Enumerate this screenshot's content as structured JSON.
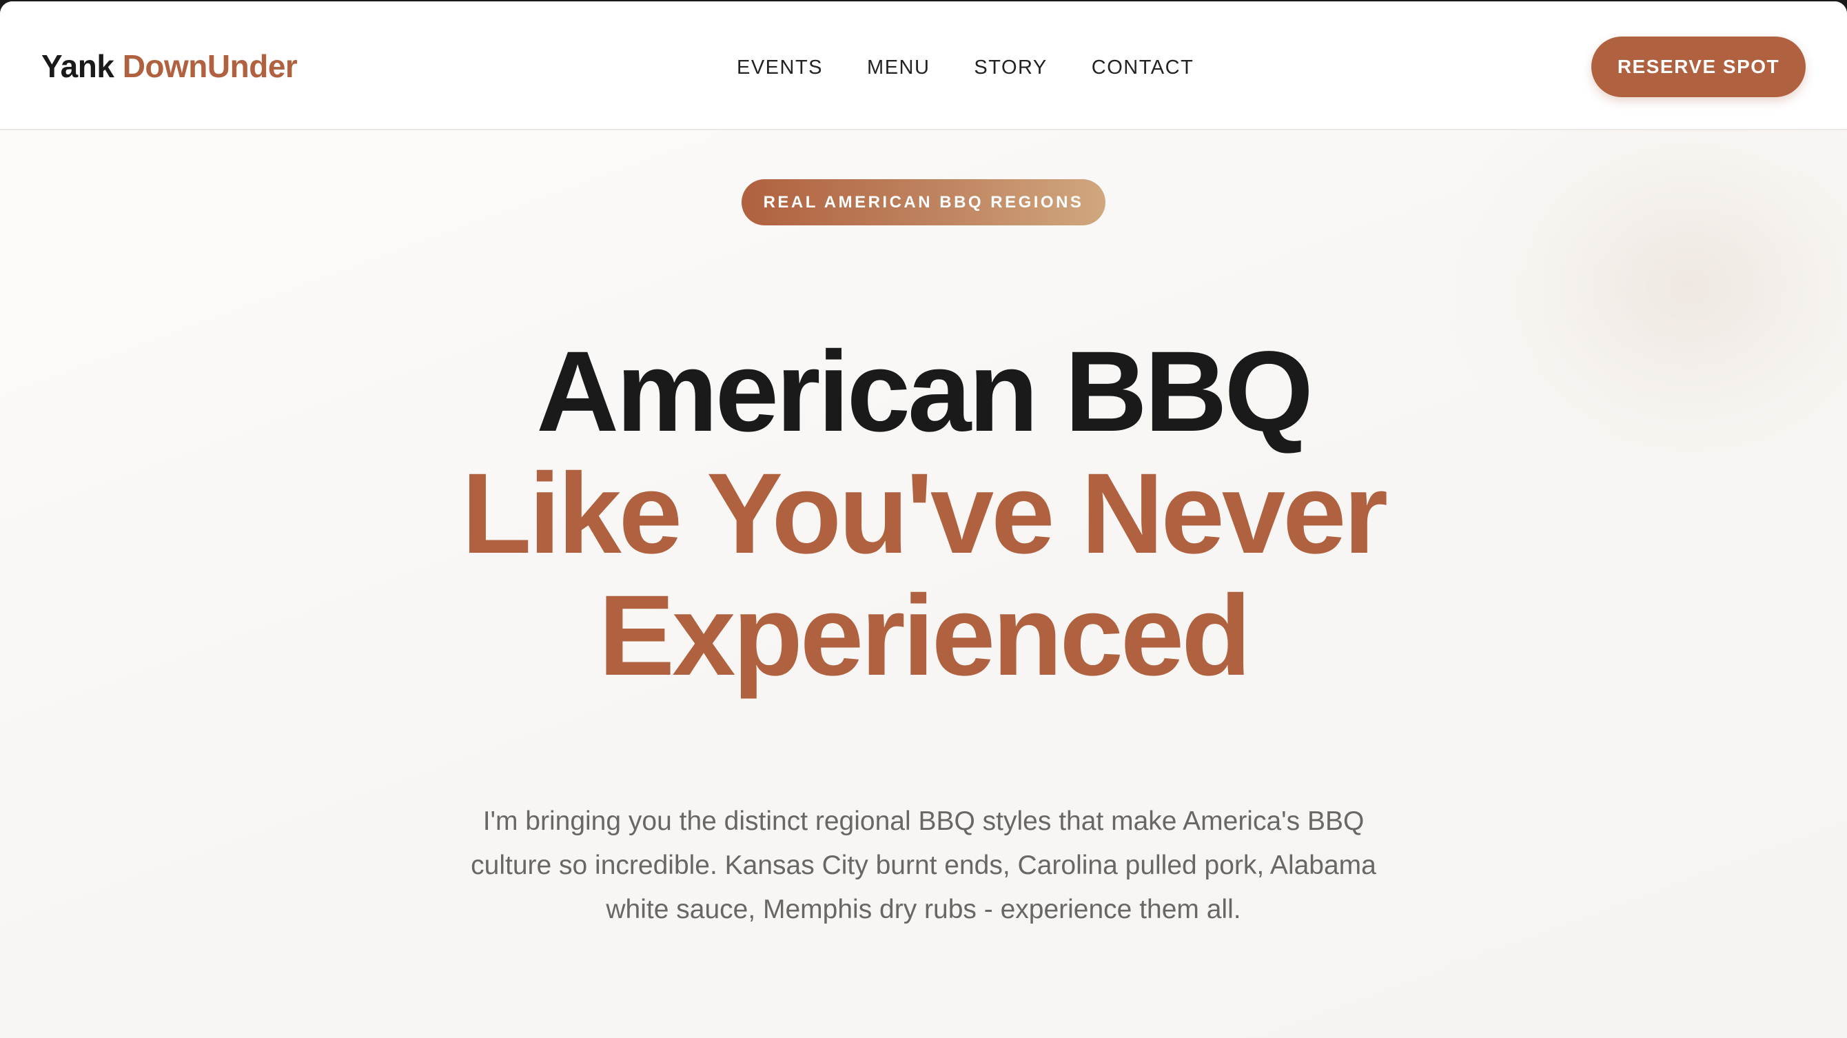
{
  "header": {
    "logo_part1": "Yank",
    "logo_part2": "DownUnder",
    "nav": [
      {
        "label": "EVENTS"
      },
      {
        "label": "MENU"
      },
      {
        "label": "STORY"
      },
      {
        "label": "CONTACT"
      }
    ],
    "cta_label": "RESERVE SPOT"
  },
  "hero": {
    "badge": "REAL AMERICAN BBQ REGIONS",
    "headline_line1": "American BBQ",
    "headline_line2": "Like You've Never",
    "headline_line3": "Experienced",
    "subtitle": "I'm bringing you the distinct regional BBQ styles that make America's BBQ culture so incredible. Kansas City burnt ends, Carolina pulled pork, Alabama white sauce, Memphis dry rubs - experience them all."
  },
  "colors": {
    "accent": "#b0613f",
    "badge_gradient_end": "#d0a77e",
    "text_dark": "#1a1a1a",
    "text_muted": "#6a6664",
    "background": "#f9f7f5"
  }
}
